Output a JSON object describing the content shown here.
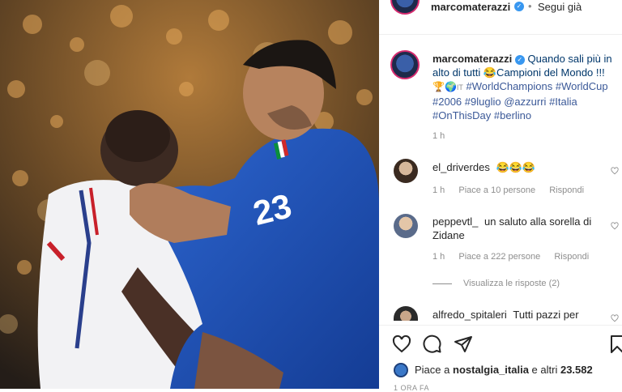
{
  "post": {
    "author": "marcomaterazzi",
    "follow_status": "Segui già",
    "dot": "•",
    "caption": {
      "author": "marcomaterazzi",
      "text": "Quando sali più in alto di tutti 😂Campioni del Mondo !!!",
      "line2_icons": "🏆🌍",
      "line2_prefix": "IT",
      "tags": [
        "#WorldChampions",
        "#WorldCup",
        "#2006",
        "#9luglio",
        "@azzurri",
        "#Italia",
        "#OnThisDay",
        "#berlino"
      ],
      "time": "1 h"
    },
    "comments": [
      {
        "user": "el_driverdes",
        "text": "😂😂😂",
        "time": "1 h",
        "likes": "Piace a 10 persone",
        "reply": "Rispondi"
      },
      {
        "user": "peppevtl_",
        "text": "un saluto alla sorella di Zidane",
        "time": "1 h",
        "likes": "Piace a 222 persone",
        "reply": "Rispondi",
        "view_replies": "Visualizza le risposte (2)"
      },
      {
        "user": "alfredo_spitaleri",
        "text": "Tutti pazzi per"
      }
    ],
    "liked_by": {
      "prefix": "Piace a",
      "user": "nostalgia_italia",
      "suffix": "e altri",
      "count": "23.582"
    },
    "footer_partial": "1 ORA FA"
  },
  "photo": {
    "jersey_number": "23"
  },
  "icons": {
    "like": "heart-icon",
    "comment": "comment-icon",
    "share": "send-icon",
    "save": "bookmark-icon",
    "verified": "verified-badge-icon"
  },
  "colors": {
    "verified": "#3897f0",
    "link": "#00376b",
    "italy_blue": "#1f4fb4",
    "france_white": "#f4f4f6"
  }
}
